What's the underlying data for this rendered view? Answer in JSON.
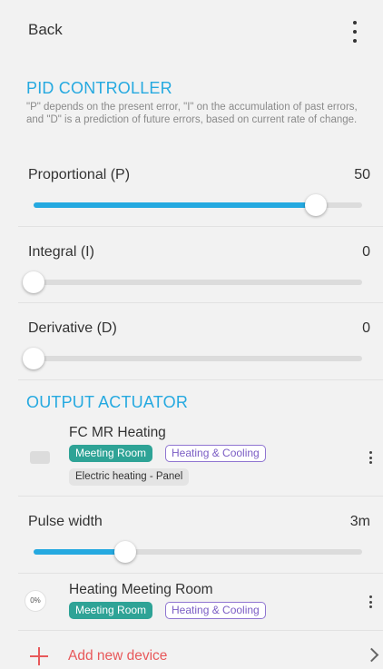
{
  "header": {
    "back_label": "Back",
    "menu_icon": "kebab-vertical-icon"
  },
  "pid": {
    "title": "PID CONTROLLER",
    "description": "\"P\" depends on the present error, \"I\" on the accumulation of past errors, and \"D\" is a prediction of future errors, based on current rate of change.",
    "proportional": {
      "label": "Proportional (P)",
      "value": "50",
      "fraction": 0.86
    },
    "integral": {
      "label": "Integral (I)",
      "value": "0",
      "fraction": 0
    },
    "derivative": {
      "label": "Derivative (D)",
      "value": "0",
      "fraction": 0
    }
  },
  "output": {
    "title": "OUTPUT ACTUATOR",
    "device1": {
      "name": "FC MR Heating",
      "room_tag": "Meeting Room",
      "category_tag": "Heating & Cooling",
      "type_tag": "Electric heating - Panel"
    },
    "pulse": {
      "label": "Pulse width",
      "value": "3m",
      "fraction": 0.28
    },
    "device2": {
      "name": "Heating Meeting Room",
      "icon_text": "0%",
      "room_tag": "Meeting Room",
      "category_tag": "Heating & Cooling"
    }
  },
  "add_device": {
    "label": "Add new device"
  },
  "colors": {
    "accent": "#25a9e0",
    "room_tag": "#2ea396",
    "category_tag": "#8f75d1",
    "add": "#e8585a"
  }
}
